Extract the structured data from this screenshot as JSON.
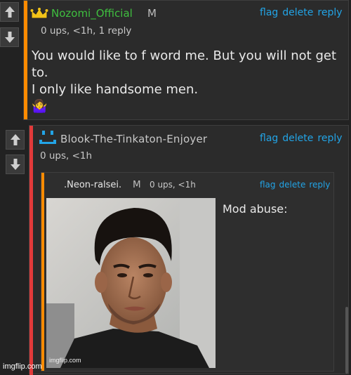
{
  "comment1": {
    "username": "Nozomi_Official",
    "badge": "M",
    "meta": "0 ups, <1h, 1 reply",
    "actions": {
      "flag": "flag",
      "delete": "delete",
      "reply": "reply"
    },
    "text_lines": [
      "You would like to f word me. But you will not get",
      "to.",
      "I only like handsome men."
    ],
    "emoji": "🤷‍♀️",
    "accent_color": "#ff8b00",
    "username_color": "#3fbf3f",
    "icon": "crown-icon"
  },
  "comment2": {
    "username": "Blook-The-Tinkaton-Enjoyer",
    "meta": "0 ups, <1h",
    "actions": {
      "flag": "flag",
      "delete": "delete",
      "reply": "reply"
    },
    "accent_color": "#e23a3a",
    "username_color": "#c8c8c8",
    "icon": "smiley-face-icon"
  },
  "comment3": {
    "username": ".Neon-ralsei.",
    "badge": "M",
    "meta": "0 ups, <1h",
    "actions": {
      "flag": "flag",
      "delete": "delete",
      "reply": "reply"
    },
    "text": "Mod abuse:",
    "accent_color": "#ff8b00",
    "username_color": "#3fbf3f"
  },
  "watermarks": {
    "main": "imgflip.com",
    "small": "imgflip.com"
  },
  "colors": {
    "link": "#22a4e6",
    "background": "#222222",
    "panel": "#2b2b2b"
  }
}
